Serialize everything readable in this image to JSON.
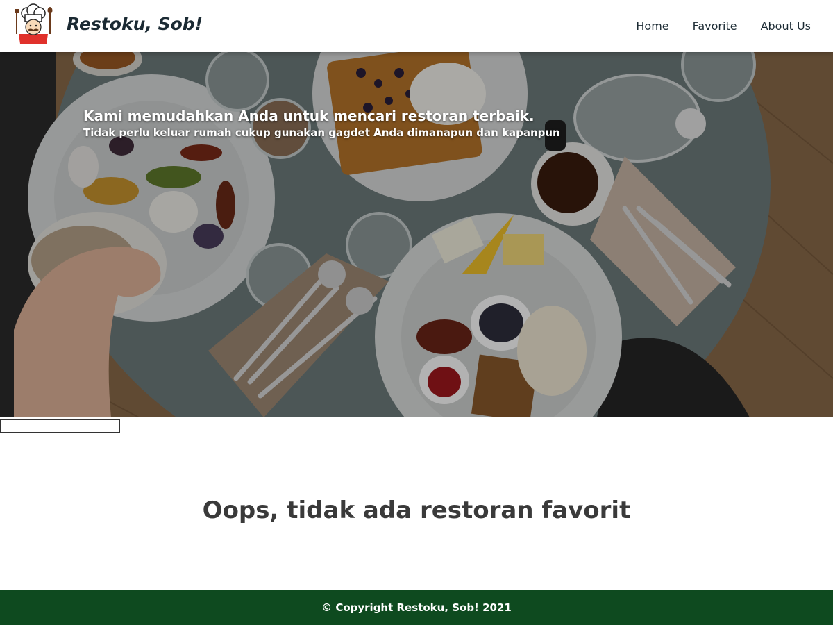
{
  "header": {
    "brand": "Restoku, Sob!",
    "logo_icon": "chef-logo-icon"
  },
  "nav": {
    "items": [
      {
        "label": "Home"
      },
      {
        "label": "Favorite"
      },
      {
        "label": "About Us"
      }
    ]
  },
  "hero": {
    "title": "Kami memudahkan Anda untuk mencari restoran terbaik.",
    "subtitle": "Tidak perlu keluar rumah cukup gunakan gagdet Anda dimanapun dan kapanpun"
  },
  "search": {
    "value": ""
  },
  "main": {
    "empty_message": "Oops, tidak ada restoran favorit"
  },
  "footer": {
    "copyright": "© Copyright Restoku, Sob! 2021"
  },
  "colors": {
    "footer_bg": "#0e4a1f",
    "text_dark": "#1b2a33"
  }
}
